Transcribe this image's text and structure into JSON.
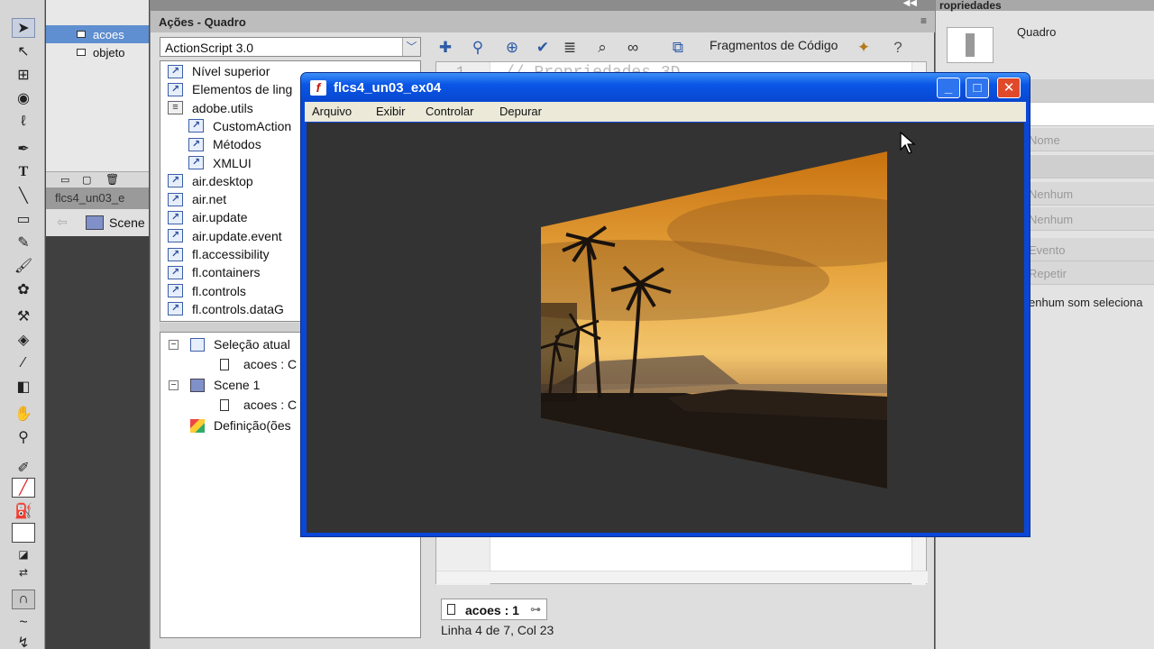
{
  "layers": {
    "items": [
      {
        "label": "acoes",
        "selected": true
      },
      {
        "label": "objeto",
        "selected": false
      }
    ],
    "timeline_tab": "flcs4_un03_e",
    "scene_label": "Scene"
  },
  "actions_panel": {
    "title": "Ações - Quadro",
    "language_select": "ActionScript 3.0",
    "library_tree": [
      {
        "label": "Nível superior",
        "indent": 0
      },
      {
        "label": "Elementos de ling",
        "indent": 0
      },
      {
        "label": "adobe.utils",
        "indent": 0,
        "open": true
      },
      {
        "label": "CustomAction",
        "indent": 1
      },
      {
        "label": "Métodos",
        "indent": 1
      },
      {
        "label": "XMLUI",
        "indent": 1
      },
      {
        "label": "air.desktop",
        "indent": 0
      },
      {
        "label": "air.net",
        "indent": 0
      },
      {
        "label": "air.update",
        "indent": 0
      },
      {
        "label": "air.update.event",
        "indent": 0
      },
      {
        "label": "fl.accessibility",
        "indent": 0
      },
      {
        "label": "fl.containers",
        "indent": 0
      },
      {
        "label": "fl.controls",
        "indent": 0
      },
      {
        "label": "fl.controls.dataG",
        "indent": 0
      }
    ],
    "outline": [
      {
        "label": "Seleção atual",
        "level": 0
      },
      {
        "label": "acoes : C",
        "level": 1
      },
      {
        "label": "Scene 1",
        "level": 0
      },
      {
        "label": "acoes : C",
        "level": 1
      },
      {
        "label": "Definição(ões",
        "level": 0
      }
    ],
    "code_snippets_label": "Fragmentos de Código",
    "code_line_number": "1",
    "code_first_line": "// Propriedades 3D",
    "script_tab": "acoes : 1",
    "status_bar": "Linha 4 de 7, Col 23"
  },
  "properties": {
    "title": "ropriedades",
    "frame_label": "Quadro",
    "rows": [
      "Nome",
      "Nenhum",
      "Nenhum",
      "Evento",
      "Repetir"
    ],
    "sound_text": "enhum som seleciona"
  },
  "swf_window": {
    "title": "flcs4_un03_ex04",
    "menu": [
      "Arquivo",
      "Exibir",
      "Controlar",
      "Depurar"
    ],
    "stage_color": "#333333"
  },
  "colors": {
    "titlebar": "#0a56e6",
    "selection": "#5f8fd0",
    "close_button": "#e04a2a"
  }
}
